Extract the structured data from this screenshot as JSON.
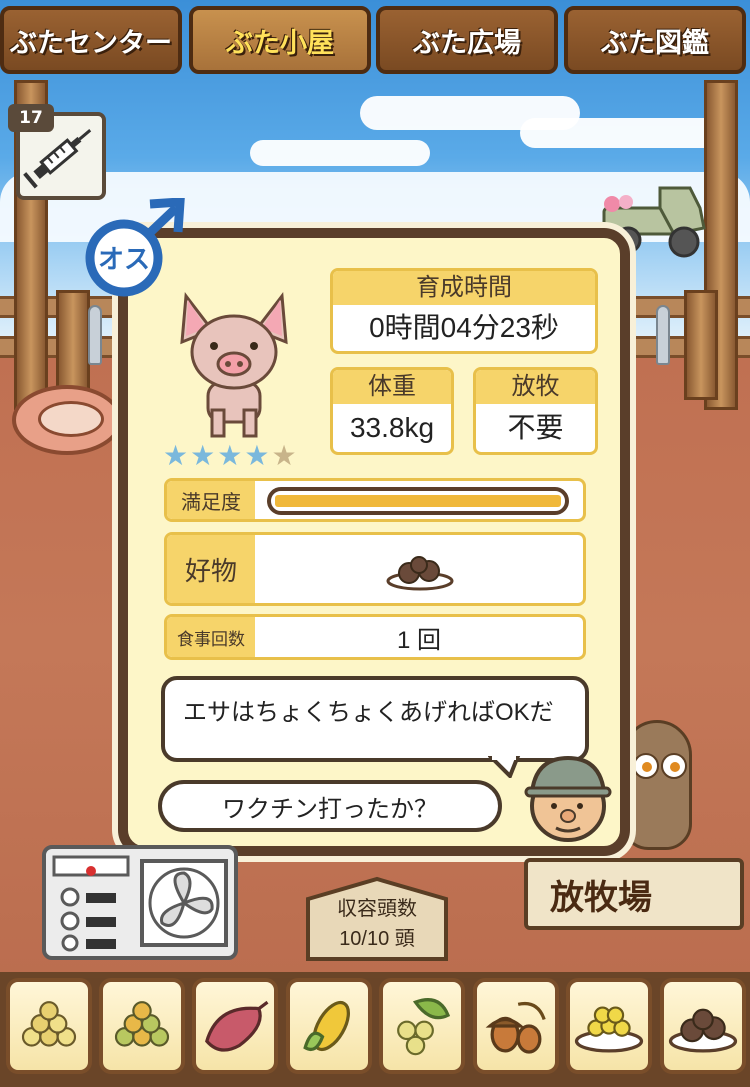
{
  "tabs": [
    {
      "label": "ぶたセンター",
      "active": false
    },
    {
      "label": "ぶた小屋",
      "active": true
    },
    {
      "label": "ぶた広場",
      "active": false
    },
    {
      "label": "ぶた図鑑",
      "active": false
    }
  ],
  "vaccine": {
    "count": "17",
    "icon": "syringe-icon"
  },
  "pig": {
    "gender_label": "オス",
    "rating": 4,
    "max_rating": 5,
    "rearing_time": {
      "label": "育成時間",
      "value": "0時間04分23秒"
    },
    "weight": {
      "label": "体重",
      "value": "33.8kg"
    },
    "grazing": {
      "label": "放牧",
      "value": "不要"
    },
    "satisfaction": {
      "label": "満足度",
      "level": 1.0
    },
    "favorite": {
      "label": "好物",
      "icon": "meatball-plate-icon"
    },
    "meals": {
      "label": "食事回数",
      "value": "1 回"
    }
  },
  "dialog": {
    "farmer_line": "エサはちょくちょくあげればOKだ",
    "question": "ワクチン打ったか？"
  },
  "capacity": {
    "label": "収容頭数",
    "value": "10/10 頭"
  },
  "pasture_sign": "放牧場",
  "feeds": [
    {
      "icon": "grain-pile-icon"
    },
    {
      "icon": "mixed-beans-icon"
    },
    {
      "icon": "sweet-potato-icon"
    },
    {
      "icon": "corn-icon"
    },
    {
      "icon": "grapes-leaf-icon"
    },
    {
      "icon": "acorn-icon"
    },
    {
      "icon": "grain-plate-icon"
    },
    {
      "icon": "meatball-plate-icon"
    }
  ],
  "colors": {
    "accent": "#f6d46a",
    "panel": "#fdf6c8",
    "border": "#5a3e2a",
    "star_on": "#7ab8dc",
    "star_off": "#c8b48a",
    "bar": "#f0b83a"
  }
}
